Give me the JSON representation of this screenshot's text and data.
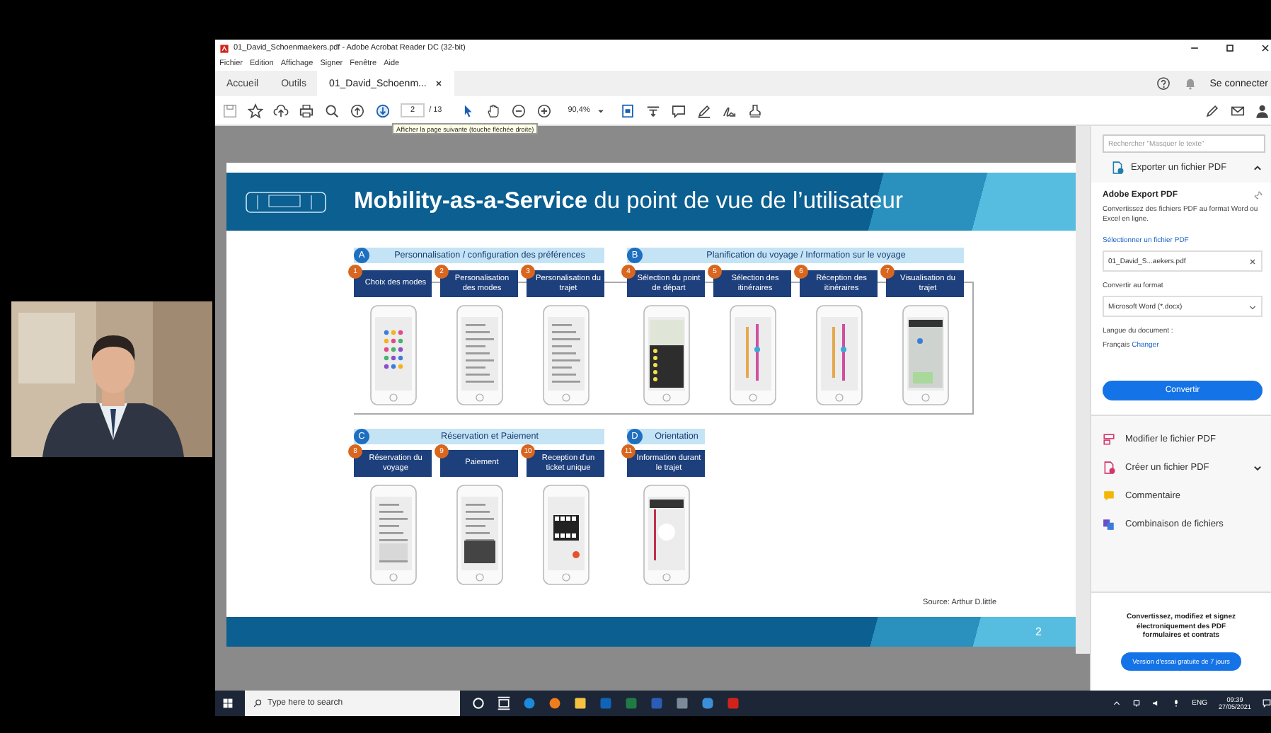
{
  "window": {
    "title": "01_David_Schoenmaekers.pdf - Adobe Acrobat Reader DC (32-bit)"
  },
  "menu": [
    "Fichier",
    "Edition",
    "Affichage",
    "Signer",
    "Fenêtre",
    "Aide"
  ],
  "tabs": [
    {
      "label": "Accueil",
      "selected": false,
      "closable": false
    },
    {
      "label": "Outils",
      "selected": false,
      "closable": false
    },
    {
      "label": "01_David_Schoenm...",
      "selected": true,
      "closable": true
    }
  ],
  "account": {
    "label": "Se connecter"
  },
  "toolbar": {
    "page": "2",
    "page_count": "/ 13",
    "zoom": "90,4%",
    "tooltip": "Afficher la page suivante (touche fléchée droite)"
  },
  "slide": {
    "title": "**Mobility-as-a-Service** du point de vue de l’utilisateur",
    "rows": [
      {
        "groups": [
          {
            "letter": "A",
            "title": "Personnalisation / configuration des préférences",
            "steps": [
              {
                "number": "1",
                "label": "Choix des modes"
              },
              {
                "number": "2",
                "label": "Personalisation des modes"
              },
              {
                "number": "3",
                "label": "Personalisation du trajet"
              }
            ]
          },
          {
            "letter": "B",
            "title": "Planification du voyage / Information sur le voyage",
            "steps": [
              {
                "number": "4",
                "label": "Sélection du point de départ"
              },
              {
                "number": "5",
                "label": "Sélection des itinéraires"
              },
              {
                "number": "6",
                "label": "Réception des itinéraires"
              },
              {
                "number": "7",
                "label": "Visualisation du trajet"
              }
            ]
          }
        ]
      },
      {
        "groups": [
          {
            "letter": "C",
            "title": "Réservation et Paiement",
            "steps": [
              {
                "number": "8",
                "label": "Réservation du voyage"
              },
              {
                "number": "9",
                "label": "Paiement"
              },
              {
                "number": "10",
                "label": "Reception d'un ticket unique"
              }
            ]
          },
          {
            "letter": "D",
            "title": "Orientation",
            "steps": [
              {
                "number": "11",
                "label": "Information durant le trajet"
              }
            ]
          }
        ]
      }
    ],
    "source": "Source: Arthur D.little",
    "page_number": "2"
  },
  "panel": {
    "search_placeholder": "Rechercher \"Masquer le texte\"",
    "export": {
      "label": "Exporter un fichier PDF",
      "expanded": true,
      "heading": "Adobe Export PDF",
      "description": "Convertissez des fichiers PDF au format Word ou Excel en ligne.",
      "select_label": "Sélectionner un fichier PDF",
      "file": "01_David_S...aekers.pdf",
      "format_label": "Convertir au format",
      "format": "Microsoft Word (*.docx)",
      "language_label": "Langue du document :",
      "language": "Français",
      "change_link": "Changer",
      "button": "Convertir"
    },
    "tools": [
      {
        "label": "Modifier le fichier PDF",
        "has_menu": false
      },
      {
        "label": "Créer un fichier PDF",
        "has_menu": true
      },
      {
        "label": "Commentaire",
        "has_menu": false
      },
      {
        "label": "Combinaison de fichiers",
        "has_menu": false
      }
    ],
    "promo": {
      "text": "Convertissez, modifiez et signez électroniquement des PDF formulaires et contrats",
      "button": "Version d'essai gratuite de 7 jours"
    }
  },
  "taskbar": {
    "search_placeholder": "Type here to search",
    "language": "ENG",
    "time": "09:39",
    "date": "27/05/2021"
  }
}
